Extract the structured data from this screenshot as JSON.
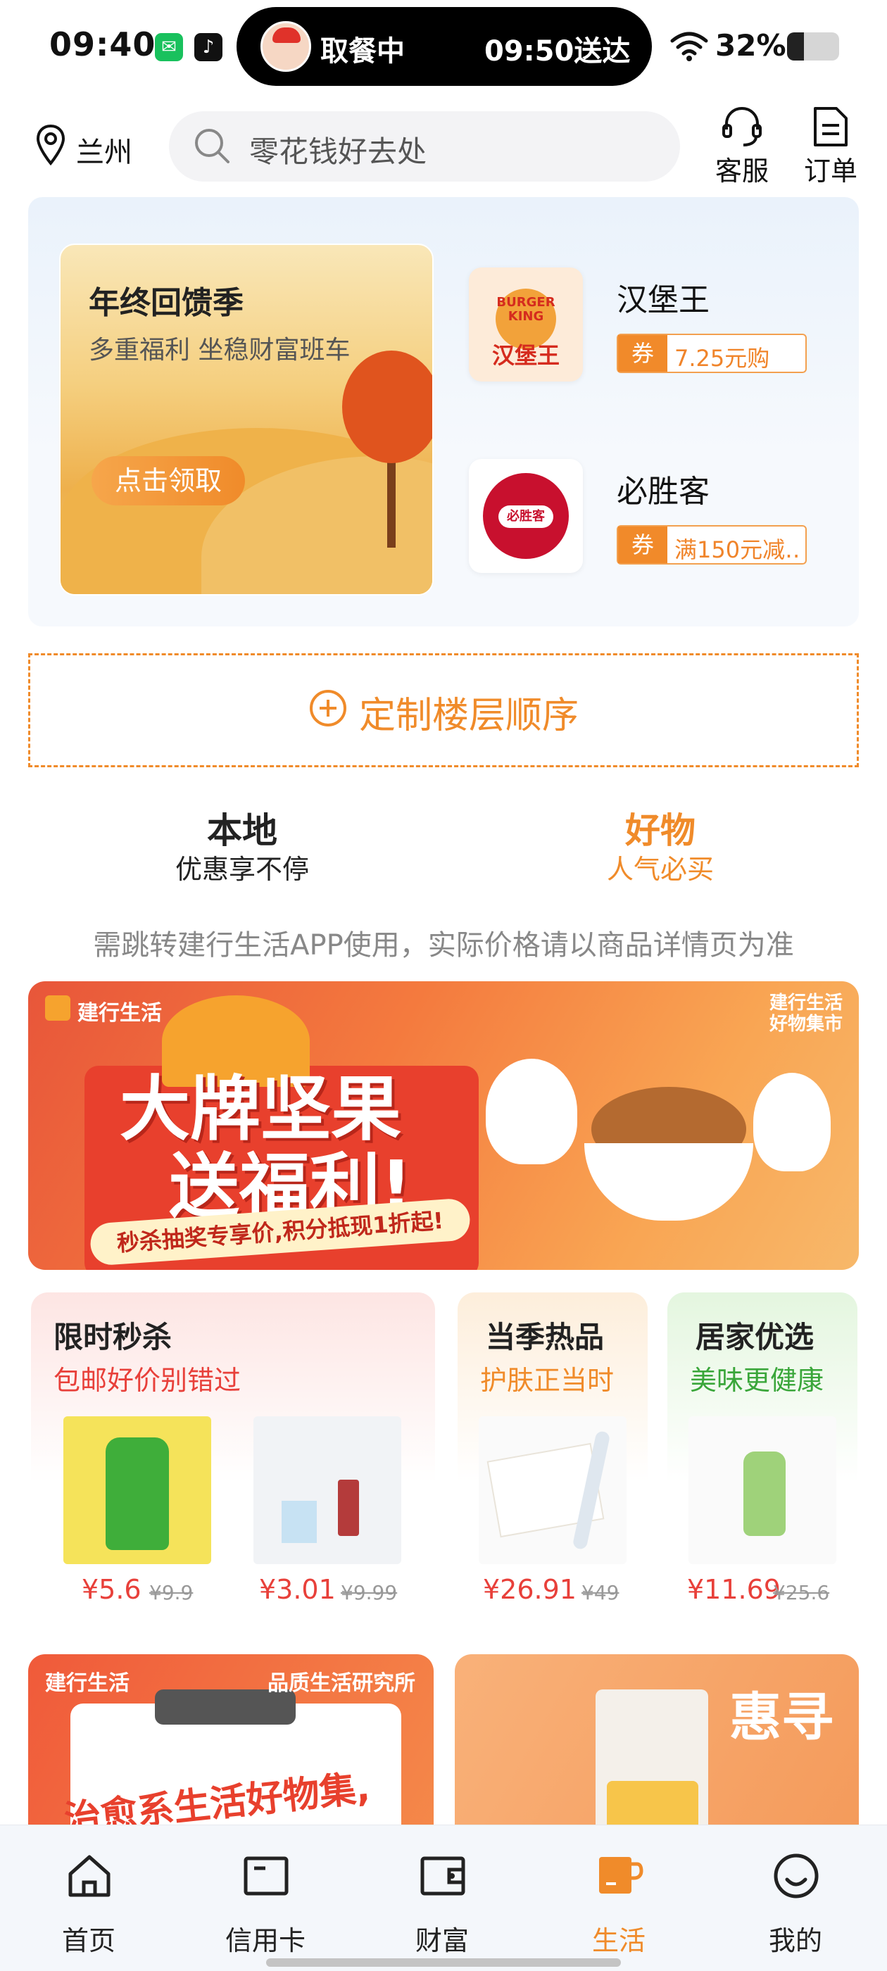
{
  "status_bar": {
    "time": "09:40",
    "pickup_status": "取餐中",
    "delivery_time": "09:50送达",
    "battery_percent": "32%",
    "battery_level": 0.32,
    "icons": [
      "wechat-icon",
      "tiktok-icon",
      "wifi-icon",
      "battery-icon"
    ]
  },
  "header": {
    "city": "兰州",
    "search_placeholder": "零花钱好去处",
    "service_label": "客服",
    "orders_label": "订单"
  },
  "promo": {
    "card_title": "年终回馈季",
    "card_subtitle": "多重福利 坐稳财富班车",
    "card_button": "点击领取",
    "brands": [
      {
        "name": "汉堡王",
        "logo_text": "汉堡王",
        "logo_top": "BURGER KING",
        "coupon_tag": "券",
        "coupon_text": "7.25元购"
      },
      {
        "name": "必胜客",
        "logo_text": "必胜客",
        "coupon_tag": "券",
        "coupon_text": "满150元减…"
      }
    ]
  },
  "customize": {
    "label": "定制楼层顺序"
  },
  "tabs": [
    {
      "title": "本地",
      "subtitle": "优惠享不停",
      "active": false
    },
    {
      "title": "好物",
      "subtitle": "人气必买",
      "active": true
    }
  ],
  "notice": "需跳转建行生活APP使用，实际价格请以商品详情页为准",
  "banner": {
    "brand": "建行生活",
    "title_line1": "大牌坚果",
    "title_line2": "送福利!",
    "tagline": "秒杀抽奖专享价,积分抵现1折起!",
    "corner_tag": "建行生活好物集市"
  },
  "product_cards": [
    {
      "title": "限时秒杀",
      "subtitle": "包邮好价别错过",
      "accent": "#e8403a",
      "items": [
        {
          "price": "¥5.6",
          "old_price": "¥9.9"
        },
        {
          "price": "¥3.01",
          "old_price": "¥9.99"
        }
      ]
    },
    {
      "title": "当季热品",
      "subtitle": "护肤正当时",
      "accent": "#f08b2a",
      "items": [
        {
          "price": "¥26.91",
          "old_price": "¥49"
        }
      ]
    },
    {
      "title": "居家优选",
      "subtitle": "美味更健康",
      "accent": "#3aa63a",
      "items": [
        {
          "price": "¥11.69",
          "old_price": "¥25.6"
        }
      ]
    }
  ],
  "bottom_cards": [
    {
      "brand": "建行生活",
      "tag": "品质生活研究所",
      "title": "治愈系生活好物集,"
    },
    {
      "title": "惠寻"
    }
  ],
  "bottom_nav": [
    {
      "label": "首页",
      "icon": "home-icon",
      "active": false
    },
    {
      "label": "信用卡",
      "icon": "credit-card-icon",
      "active": false
    },
    {
      "label": "财富",
      "icon": "wallet-icon",
      "active": false
    },
    {
      "label": "生活",
      "icon": "coffee-cup-icon",
      "active": true
    },
    {
      "label": "我的",
      "icon": "smiley-icon",
      "active": false
    }
  ],
  "colors": {
    "accent": "#f08b2a",
    "price_red": "#e8403a"
  }
}
